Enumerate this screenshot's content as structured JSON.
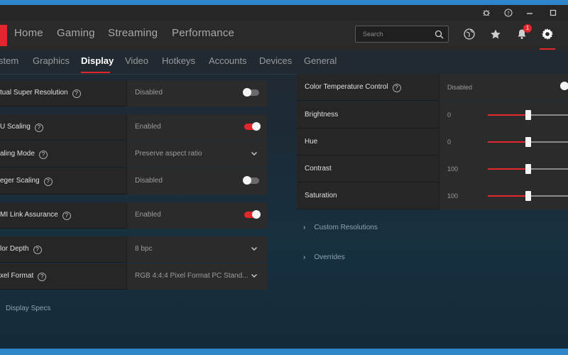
{
  "nav": {
    "items": [
      "Home",
      "Gaming",
      "Streaming",
      "Performance"
    ],
    "search_placeholder": "Search",
    "notification_count": "1"
  },
  "tabs": [
    "stem",
    "Graphics",
    "Display",
    "Video",
    "Hotkeys",
    "Accounts",
    "Devices",
    "General"
  ],
  "active_tab": "Display",
  "left_rows": [
    {
      "label": "tual Super Resolution",
      "value": "Disabled",
      "control": "toggle-off"
    },
    {
      "label": "U Scaling",
      "value": "Enabled",
      "control": "toggle-on"
    },
    {
      "label": "aling Mode",
      "value": "Preserve aspect ratio",
      "control": "dropdown"
    },
    {
      "label": "eger Scaling",
      "value": "Disabled",
      "control": "toggle-off"
    },
    {
      "label": "MI Link Assurance",
      "value": "Enabled",
      "control": "toggle-on"
    },
    {
      "label": "lor Depth",
      "value": "8 bpc",
      "control": "dropdown"
    },
    {
      "label": "xel Format",
      "value": "RGB 4:4:4 Pixel Format PC Stand...",
      "control": "dropdown"
    }
  ],
  "display_specs": "Display Specs",
  "right_rows": [
    {
      "label": "Color Temperature Control",
      "value": "Disabled",
      "control": "toggle-off"
    },
    {
      "label": "Brightness",
      "value": "0",
      "slider_fraction": 0.5
    },
    {
      "label": "Hue",
      "value": "0",
      "slider_fraction": 0.5
    },
    {
      "label": "Contrast",
      "value": "100",
      "slider_fraction": 0.5
    },
    {
      "label": "Saturation",
      "value": "100",
      "slider_fraction": 0.5
    }
  ],
  "expanders": [
    "Custom Resolutions",
    "Overrides"
  ],
  "colors": {
    "accent": "#e1262d",
    "taskbar": "#2f87c9"
  }
}
